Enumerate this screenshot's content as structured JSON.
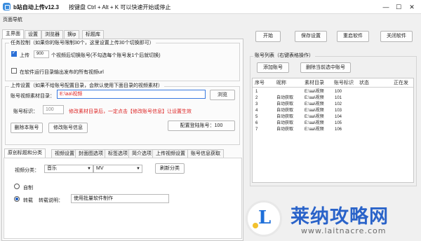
{
  "window": {
    "title": "b站自动上传v12.3",
    "hotkey_hint": "按键盘 Ctrl + Alt + K 可以快速开始或停止"
  },
  "menu": {
    "nav_label": "页面导航"
  },
  "tabs": [
    "主界面",
    "设置",
    "浏览器",
    "换ip",
    "标题库"
  ],
  "task_control": {
    "legend": "任务控制（如果你的账号限制30个，这里设置上传30个切换即可）",
    "upload_label": "上传",
    "upload_count": "900",
    "switch_text": "个视频后切换账号(不勾选每个账号发1个后就切换)",
    "auto_save_label": "在软件运行目录输出发布的所有视频url"
  },
  "upload_settings": {
    "legend": "上传设置（如果不给账号配置目录，会默认使用下面目录的视频素材）",
    "dir_label": "账号视频素材目录：",
    "dir_value": "E:\\aa\\视频",
    "browse_label": "浏览",
    "account_id_label": "账号标识：",
    "account_id_value": "100",
    "hint_text": "修改素材目录后，一定点击【修改账号信息】让设置生效",
    "delete_label": "删除本账号",
    "modify_label": "修改账号信息",
    "config_count_label": "配置登陆账号：100"
  },
  "lower_tabs": [
    "原创标题和分类",
    "视频设置",
    "封面图选项",
    "标签选项",
    "简介选项",
    "上传视频设置",
    "账号信息获取"
  ],
  "category": {
    "label": "视频分类：",
    "main_value": "音乐",
    "sub_value": "MV",
    "refresh_label": "刷新分类"
  },
  "source": {
    "original_label": "自制",
    "repost_label": "转载",
    "repost_note_label": "转载说明：",
    "repost_note_value": "使用批量软件制作"
  },
  "toolbar": {
    "start": "开始",
    "save": "保存设置",
    "restart": "重启软件",
    "close": "关闭软件"
  },
  "account_list": {
    "legend": "账号列表（右键表格操作）",
    "add_label": "添加账号",
    "delete_label": "删除当前选中账号",
    "columns": [
      "序号",
      "昵称",
      "素材目录",
      "账号标识",
      "状态",
      "正在发"
    ],
    "rows": [
      {
        "no": "1",
        "nick": "",
        "dir": "E:\\aa\\视频",
        "id": "100"
      },
      {
        "no": "2",
        "nick": "自动获取",
        "dir": "E:\\aa\\视频",
        "id": "101"
      },
      {
        "no": "3",
        "nick": "自动获取",
        "dir": "E:\\aa\\视频",
        "id": "102"
      },
      {
        "no": "4",
        "nick": "自动获取",
        "dir": "E:\\aa\\视频",
        "id": "103"
      },
      {
        "no": "5",
        "nick": "自动获取",
        "dir": "E:\\aa\\视频",
        "id": "104"
      },
      {
        "no": "6",
        "nick": "自动获取",
        "dir": "E:\\aa\\视频",
        "id": "105"
      },
      {
        "no": "7",
        "nick": "自动获取",
        "dir": "E:\\aa\\视频",
        "id": "106"
      }
    ]
  },
  "watermark": {
    "title": "莱纳攻略网",
    "url": "www.laitnacre.com",
    "logo_letter": "L"
  },
  "colors": {
    "accent": "#2a6fd6",
    "hint_red": "#dd2222",
    "watermark_blue": "#2a63c9"
  }
}
